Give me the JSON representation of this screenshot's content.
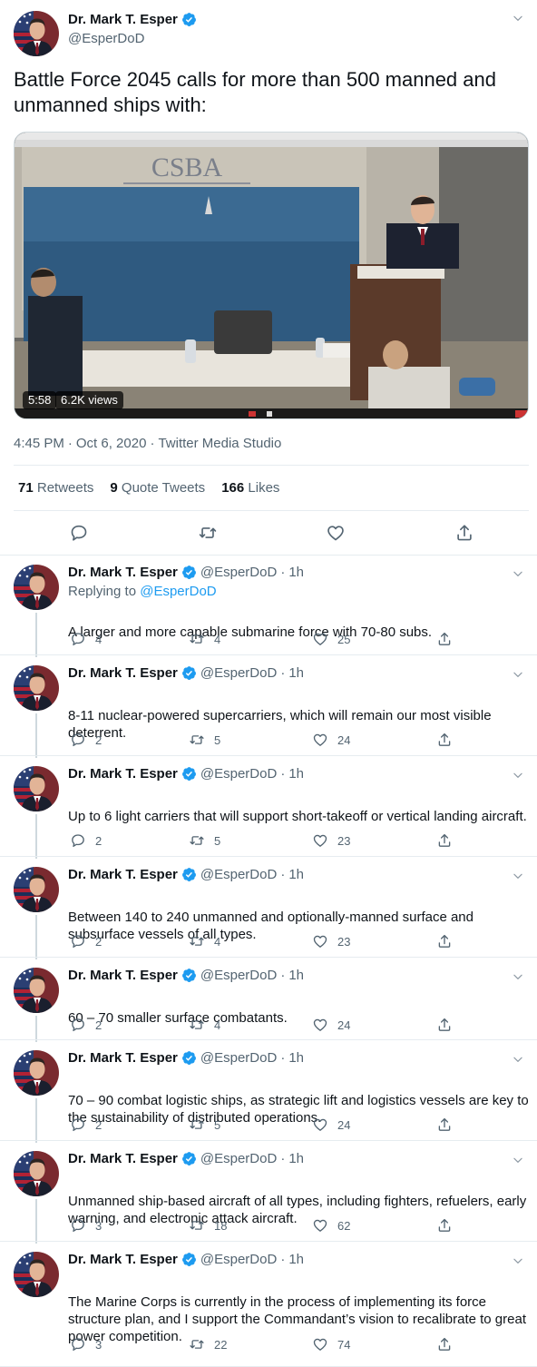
{
  "main_tweet": {
    "author_name": "Dr. Mark T. Esper",
    "author_handle": "@EsperDoD",
    "text": "Battle Force 2045 calls for more than 500 manned and unmanned ships with:",
    "video": {
      "duration": "5:58",
      "views": "6.2K views",
      "banner_text": "CSBA"
    },
    "time": "4:45 PM",
    "date": "Oct 6, 2020",
    "source": "Twitter Media Studio",
    "separator": "·",
    "stats": {
      "retweets_count": "71",
      "retweets_label": "Retweets",
      "quote_count": "9",
      "quote_label": "Quote Tweets",
      "likes_count": "166",
      "likes_label": "Likes"
    }
  },
  "replies": [
    {
      "name": "Dr. Mark T. Esper",
      "handle": "@EsperDoD",
      "dot": "·",
      "time": "1h",
      "replying_prefix": "Replying to",
      "replying_to": "@EsperDoD",
      "text": "A larger and more capable submarine force with 70-80 subs.",
      "replies": "4",
      "retweets": "4",
      "likes": "25"
    },
    {
      "name": "Dr. Mark T. Esper",
      "handle": "@EsperDoD",
      "dot": "·",
      "time": "1h",
      "text": "8-11 nuclear-powered supercarriers, which will remain our most visible deterrent.",
      "replies": "2",
      "retweets": "5",
      "likes": "24"
    },
    {
      "name": "Dr. Mark T. Esper",
      "handle": "@EsperDoD",
      "dot": "·",
      "time": "1h",
      "text": "Up to 6 light carriers that will support short-takeoff or vertical landing aircraft.",
      "replies": "2",
      "retweets": "5",
      "likes": "23"
    },
    {
      "name": "Dr. Mark T. Esper",
      "handle": "@EsperDoD",
      "dot": "·",
      "time": "1h",
      "text": "Between 140 to 240 unmanned and optionally-manned surface and subsurface vessels of all types.",
      "replies": "2",
      "retweets": "4",
      "likes": "23"
    },
    {
      "name": "Dr. Mark T. Esper",
      "handle": "@EsperDoD",
      "dot": "·",
      "time": "1h",
      "text": "60 – 70 smaller surface combatants.",
      "replies": "2",
      "retweets": "4",
      "likes": "24"
    },
    {
      "name": "Dr. Mark T. Esper",
      "handle": "@EsperDoD",
      "dot": "·",
      "time": "1h",
      "text": "70 – 90 combat logistic ships, as strategic lift and logistics vessels are key to the sustainability of distributed operations.",
      "replies": "2",
      "retweets": "5",
      "likes": "24"
    },
    {
      "name": "Dr. Mark T. Esper",
      "handle": "@EsperDoD",
      "dot": "·",
      "time": "1h",
      "text": "Unmanned ship-based aircraft of all types, including fighters, refuelers, early warning, and electronic attack aircraft.",
      "replies": "3",
      "retweets": "18",
      "likes": "62"
    },
    {
      "name": "Dr. Mark T. Esper",
      "handle": "@EsperDoD",
      "dot": "·",
      "time": "1h",
      "text": "The Marine Corps is currently in the process of implementing its force structure plan, and I support the Commandant’s vision to recalibrate to great power competition.",
      "replies": "3",
      "retweets": "22",
      "likes": "74"
    }
  ],
  "icons": {
    "verified": "verified-badge-icon",
    "caret": "chevron-down-icon",
    "reply": "reply-icon",
    "retweet": "retweet-icon",
    "like": "heart-icon",
    "share": "share-icon"
  },
  "colors": {
    "accent": "#1d9bf0",
    "secondary_text": "#536471",
    "primary_text": "#0f1419",
    "border": "#e6ecf0"
  }
}
